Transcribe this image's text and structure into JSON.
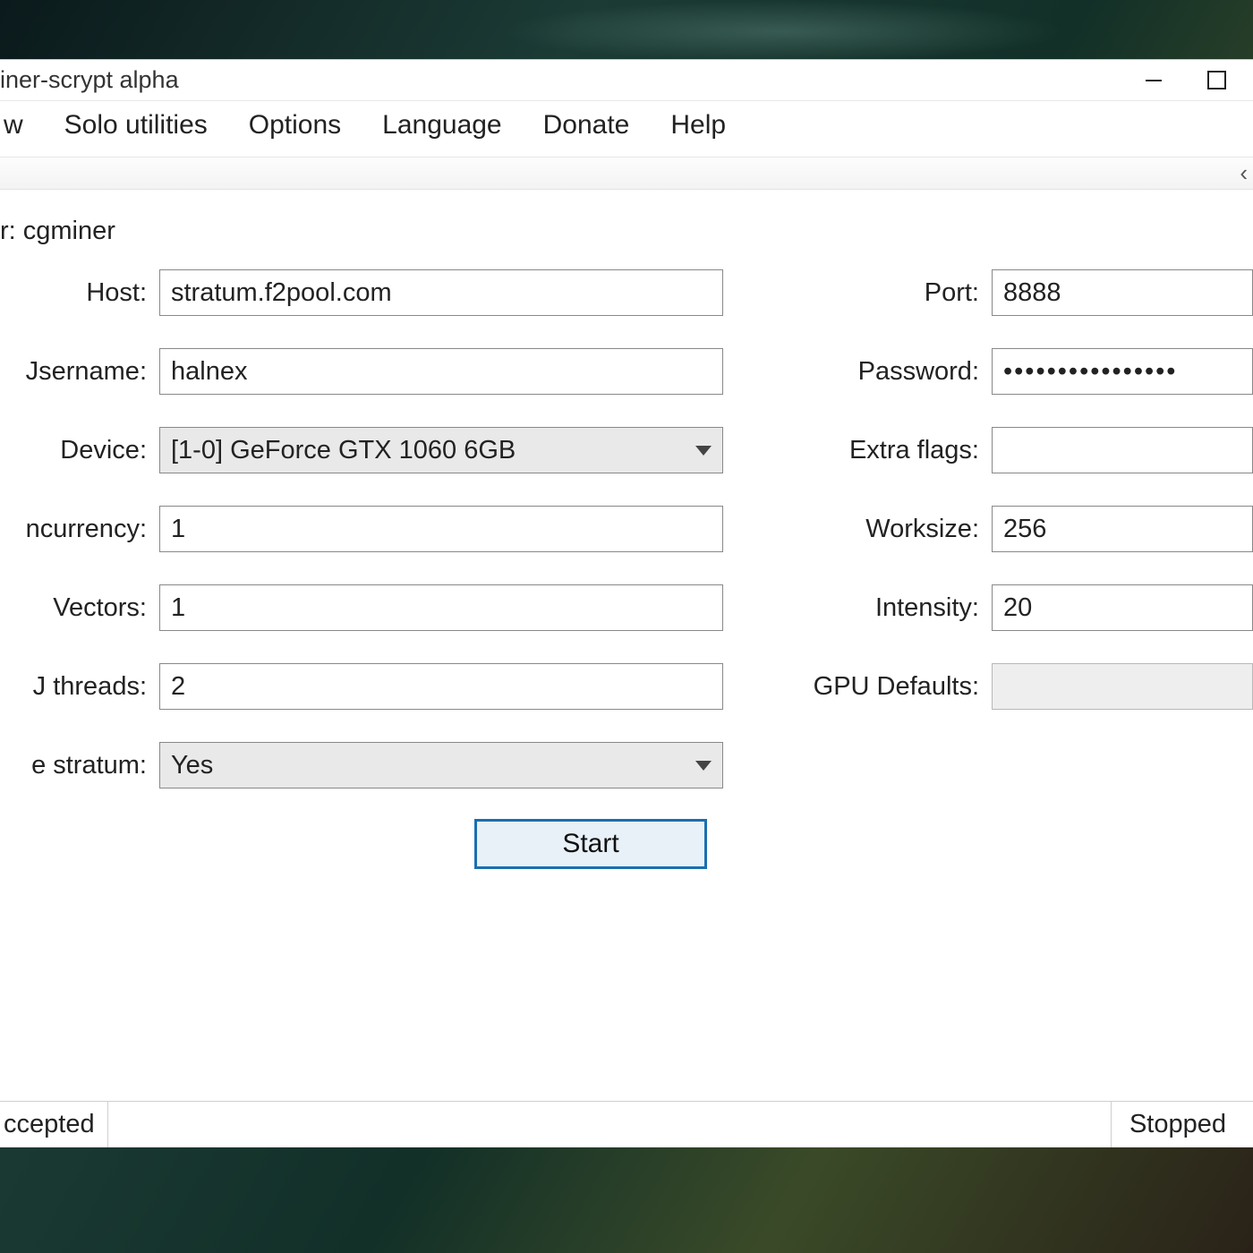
{
  "window": {
    "title": "iner-scrypt alpha"
  },
  "menu": {
    "view": "w",
    "solo_utilities": "Solo utilities",
    "options": "Options",
    "language": "Language",
    "donate": "Donate",
    "help": "Help"
  },
  "section": {
    "miner_label": "r: cgminer"
  },
  "form": {
    "host_label": "Host:",
    "host_value": "stratum.f2pool.com",
    "port_label": "Port:",
    "port_value": "8888",
    "username_label": "Jsername:",
    "username_value": "halnex",
    "password_label": "Password:",
    "password_value": "••••••••••••••••",
    "device_label": "Device:",
    "device_value": "[1-0] GeForce GTX 1060 6GB",
    "extra_flags_label": "Extra flags:",
    "extra_flags_value": "",
    "concurrency_label": "ncurrency:",
    "concurrency_value": "1",
    "worksize_label": "Worksize:",
    "worksize_value": "256",
    "vectors_label": "Vectors:",
    "vectors_value": "1",
    "intensity_label": "Intensity:",
    "intensity_value": "20",
    "threads_label": "J threads:",
    "threads_value": "2",
    "gpu_defaults_label": "GPU Defaults:",
    "stratum_label": "e stratum:",
    "stratum_value": "Yes"
  },
  "buttons": {
    "start": "Start"
  },
  "status": {
    "left": "ccepted",
    "right": "Stopped"
  }
}
